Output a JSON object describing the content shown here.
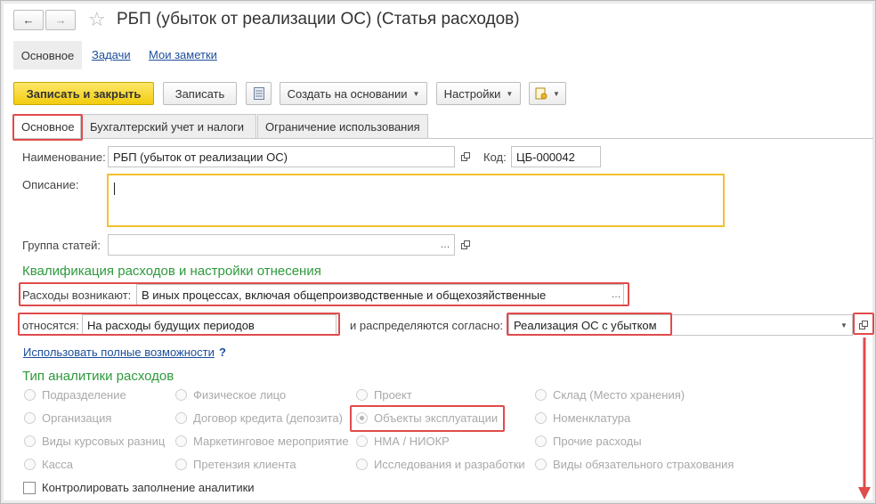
{
  "window": {
    "title": "РБП (убыток от реализации ОС) (Статья расходов)"
  },
  "nav_tabs": [
    {
      "label": "Основное"
    },
    {
      "label": "Задачи"
    },
    {
      "label": "Мои заметки"
    }
  ],
  "toolbar": {
    "save_close_label": "Записать и закрыть",
    "save_label": "Записать",
    "create_based_label": "Создать на основании",
    "settings_label": "Настройки"
  },
  "form_tabs": [
    {
      "label": "Основное"
    },
    {
      "label": "Бухгалтерский учет и налоги"
    },
    {
      "label": "Ограничение использования"
    }
  ],
  "fields": {
    "name_label": "Наименование:",
    "name_value": "РБП (убыток от реализации ОС)",
    "code_label": "Код:",
    "code_value": "ЦБ-000042",
    "description_label": "Описание:",
    "description_value": "",
    "group_label": "Группа статей:",
    "group_value": ""
  },
  "qualification": {
    "title": "Квалификация расходов и настройки отнесения",
    "arise_label": "Расходы возникают:",
    "arise_value": "В иных процессах, включая общепроизводственные и общехозяйственные",
    "relate_label": "относятся:",
    "relate_value": "На расходы будущих периодов",
    "distribute_label": "и распределяются согласно:",
    "distribute_value": "Реализация ОС с убытком",
    "full_link": "Использовать полные возможности",
    "help": "?"
  },
  "analytics": {
    "title": "Тип аналитики расходов",
    "col1": [
      "Подразделение",
      "Организация",
      "Виды курсовых разниц",
      "Касса"
    ],
    "col2": [
      "Физическое лицо",
      "Договор кредита (депозита)",
      "Маркетинговое мероприятие",
      "Претензия клиента"
    ],
    "col3": [
      "Проект",
      "Объекты эксплуатации",
      "НМА / НИОКР",
      "Исследования и разработки"
    ],
    "col4": [
      "Склад (Место хранения)",
      "Номенклатура",
      "Прочие расходы",
      "Виды обязательного страхования"
    ],
    "selected": "Объекты эксплуатации",
    "control_label": "Контролировать заполнение аналитики"
  },
  "colors": {
    "accent_yellow": "#f2cc0f",
    "highlight_red": "#e04b4b",
    "section_green": "#2e9a3c",
    "link_blue": "#1c4e9b"
  }
}
